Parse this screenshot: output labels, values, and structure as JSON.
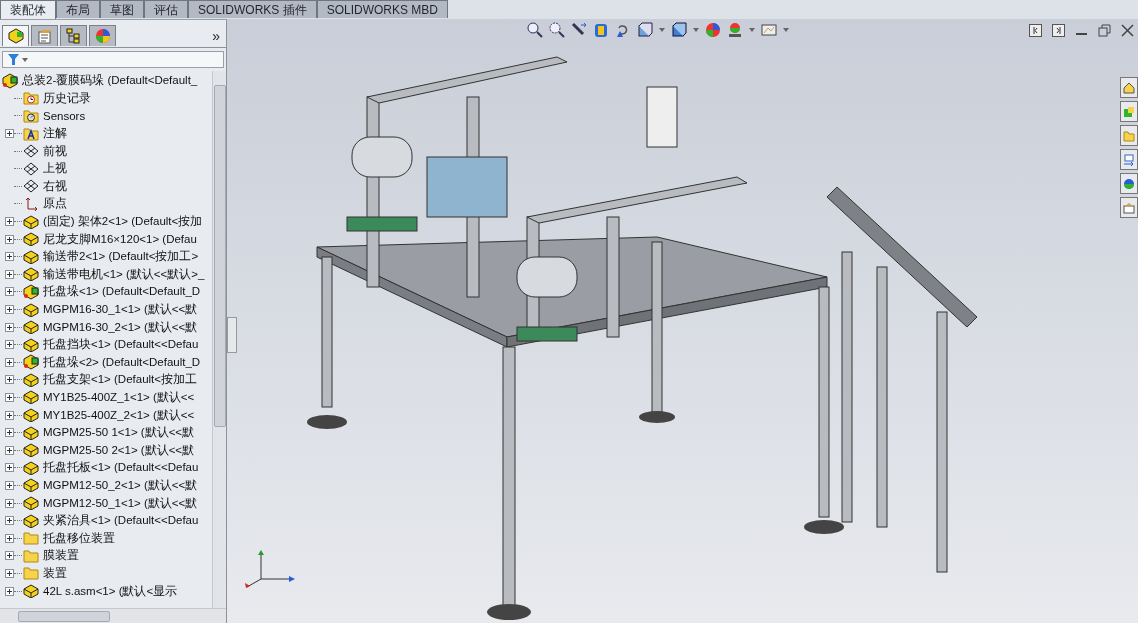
{
  "command_tabs": [
    {
      "label": "装配体",
      "selected": true
    },
    {
      "label": "布局",
      "selected": false
    },
    {
      "label": "草图",
      "selected": false
    },
    {
      "label": "评估",
      "selected": false
    },
    {
      "label": "SOLIDWORKS 插件",
      "selected": false
    },
    {
      "label": "SOLIDWORKS MBD",
      "selected": false
    }
  ],
  "panel_tabs": [
    {
      "kind": "feature",
      "selected": true
    },
    {
      "kind": "property",
      "selected": false
    },
    {
      "kind": "config",
      "selected": false
    },
    {
      "kind": "display",
      "selected": false
    }
  ],
  "panel_more": "»",
  "tree": {
    "label": "总装2-覆膜码垛  (Default<Default_",
    "children": [
      {
        "label": "历史记录",
        "kind": "history",
        "expandable": false
      },
      {
        "label": "Sensors",
        "kind": "sensors",
        "expandable": false
      },
      {
        "label": "注解",
        "kind": "annotation",
        "expandable": true
      },
      {
        "label": "前视",
        "kind": "plane",
        "expandable": false
      },
      {
        "label": "上视",
        "kind": "plane",
        "expandable": false
      },
      {
        "label": "右视",
        "kind": "plane",
        "expandable": false
      },
      {
        "label": "原点",
        "kind": "origin",
        "expandable": false
      },
      {
        "label": "(固定) 架体2<1> (Default<按加",
        "kind": "part",
        "expandable": true
      },
      {
        "label": "尼龙支脚M16×120<1> (Defau",
        "kind": "part",
        "expandable": true
      },
      {
        "label": "输送带2<1> (Default<按加工>",
        "kind": "part",
        "expandable": true
      },
      {
        "label": "输送带电机<1> (默认<<默认>_",
        "kind": "part",
        "expandable": true
      },
      {
        "label": "托盘垛<1> (Default<Default_D",
        "kind": "assembly",
        "expandable": true
      },
      {
        "label": "MGPM16-30_1<1> (默认<<默",
        "kind": "part",
        "expandable": true
      },
      {
        "label": "MGPM16-30_2<1> (默认<<默",
        "kind": "part",
        "expandable": true
      },
      {
        "label": "托盘挡块<1> (Default<<Defau",
        "kind": "part",
        "expandable": true
      },
      {
        "label": "托盘垛<2> (Default<Default_D",
        "kind": "assembly",
        "expandable": true
      },
      {
        "label": "托盘支架<1> (Default<按加工",
        "kind": "part",
        "expandable": true
      },
      {
        "label": "MY1B25-400Z_1<1> (默认<<",
        "kind": "part",
        "expandable": true
      },
      {
        "label": "MY1B25-400Z_2<1> (默认<<",
        "kind": "part",
        "expandable": true
      },
      {
        "label": "MGPM25-50 1<1> (默认<<默",
        "kind": "part",
        "expandable": true
      },
      {
        "label": "MGPM25-50 2<1> (默认<<默",
        "kind": "part",
        "expandable": true
      },
      {
        "label": "托盘托板<1> (Default<<Defau",
        "kind": "part",
        "expandable": true
      },
      {
        "label": "MGPM12-50_2<1> (默认<<默",
        "kind": "part",
        "expandable": true
      },
      {
        "label": "MGPM12-50_1<1> (默认<<默",
        "kind": "part",
        "expandable": true
      },
      {
        "label": "夹紧治具<1> (Default<<Defau",
        "kind": "part",
        "expandable": true
      },
      {
        "label": "托盘移位装置",
        "kind": "folder",
        "expandable": true
      },
      {
        "label": "膜装置",
        "kind": "folder",
        "expandable": true
      },
      {
        "label": "装置",
        "kind": "folder",
        "expandable": true
      },
      {
        "label": "42L s.asm<1> (默认<显示",
        "kind": "part",
        "expandable": true
      }
    ]
  }
}
